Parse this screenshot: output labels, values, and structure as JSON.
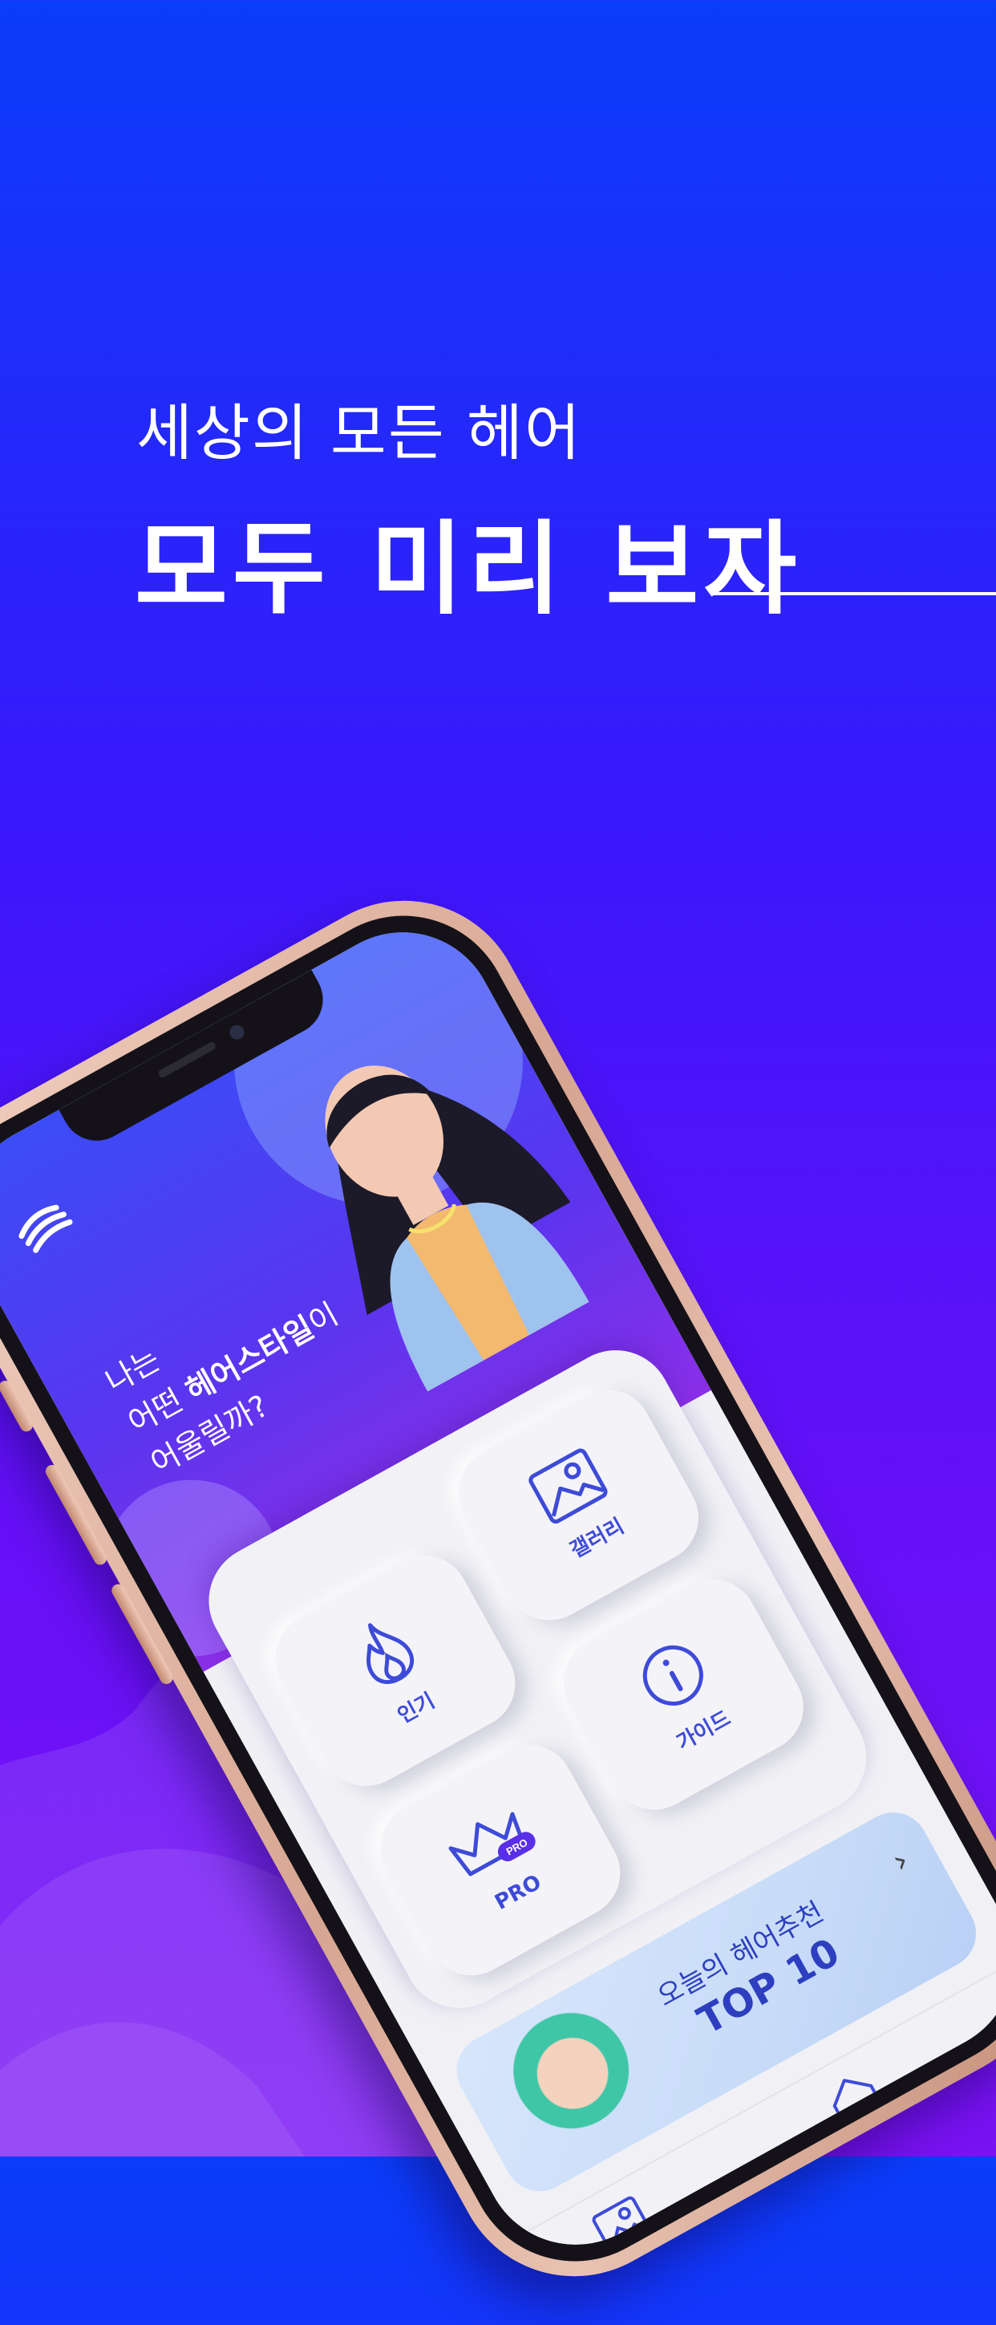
{
  "hero": {
    "subtitle": "세상의 모든 헤어",
    "title": "모두 미리 보자"
  },
  "app": {
    "question": {
      "line1": "나는",
      "line2_prefix": "어떤 ",
      "line2_highlight": "헤어스타일",
      "line2_suffix": "이",
      "line3": "어울릴까?"
    },
    "menu": [
      {
        "label": "인기",
        "icon": "flame-icon"
      },
      {
        "label": "갤러리",
        "icon": "image-icon"
      },
      {
        "label": "PRO",
        "icon": "crown-icon",
        "badge": "PRO"
      },
      {
        "label": "가이드",
        "icon": "info-icon"
      }
    ],
    "banner": {
      "subtitle": "오늘의 헤어추천",
      "title": "TOP 10",
      "arrow": "›"
    },
    "tabbar": [
      {
        "icon": "image-icon"
      },
      {
        "icon": "home-icon"
      }
    ]
  },
  "colors": {
    "bg_top": "#0a3dfa",
    "bg_bottom": "#7a12f3",
    "accent": "#3e4bd8",
    "frame": "#d7a692"
  }
}
